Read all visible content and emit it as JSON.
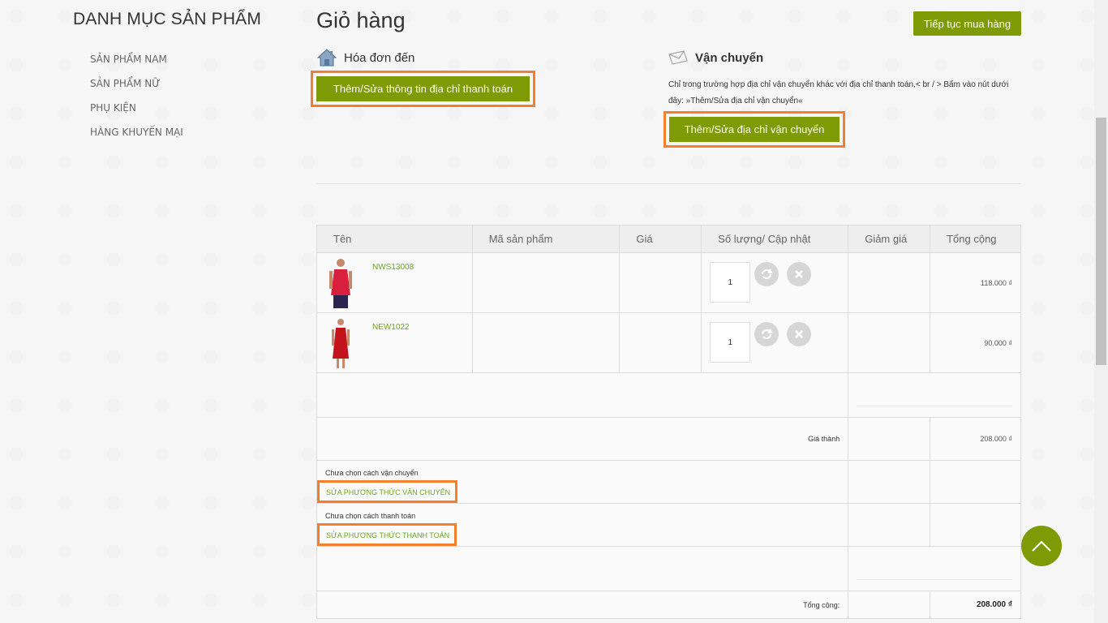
{
  "sidebar": {
    "title": "DANH MỤC SẢN PHẨM",
    "items": [
      {
        "label": "SẢN PHẨM NAM"
      },
      {
        "label": "SẢN PHẨM NỮ"
      },
      {
        "label": "PHỤ KIỆN"
      },
      {
        "label": "HÀNG KHUYẾN MẠI"
      }
    ]
  },
  "main": {
    "title": "Giỏ hàng",
    "continue_label": "Tiếp tục mua hàng",
    "billing": {
      "title": "Hóa đơn đến",
      "button_label": "Thêm/Sửa thông tin địa chỉ thanh toán"
    },
    "shipping": {
      "title": "Vận chuyển",
      "note": "Chỉ trong trường hợp địa chỉ vận chuyển khác với địa chỉ thanh toán,< br / > Bấm vào nút dưới đây: »Thêm/Sửa địa chỉ vận chuyển«",
      "button_label": "Thêm/Sửa địa chỉ vận chuyển"
    }
  },
  "cart": {
    "headers": [
      "Tên",
      "Mã sản phẩm",
      "Giá",
      "Số lượng/ Cập nhật",
      "Giảm giá",
      "Tổng cộng"
    ],
    "items": [
      {
        "code": "NWS13008",
        "qty": "1",
        "total": "118.000 ₫",
        "image_icon": "red-tank-top-image"
      },
      {
        "code": "NEW1022",
        "qty": "1",
        "total": "90.000 ₫",
        "image_icon": "red-dress-image"
      }
    ],
    "subtotal_label": "Giá thành",
    "subtotal_value": "208.000 ₫",
    "shipping_method_text": "Chưa chọn cách vận chuyển",
    "shipping_method_link": "SỬA PHƯƠNG THỨC VẬN CHUYỂN",
    "payment_method_text": "Chưa chọn cách thanh toán",
    "payment_method_link": "SỬA PHƯƠNG THỨC THANH TOÁN",
    "total_label": "Tổng cộng:",
    "total_value": "208.000 ₫"
  },
  "colors": {
    "accent": "#7e9b05",
    "highlight": "#f47f2a",
    "link": "#6aa51d"
  }
}
